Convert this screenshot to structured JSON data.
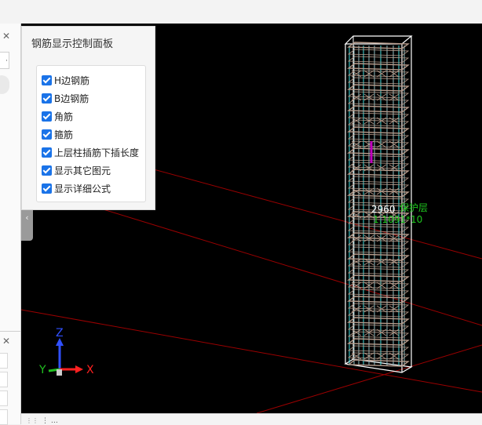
{
  "panel": {
    "title": "钢筋显示控制面板",
    "options": [
      {
        "label": "H边钢筋",
        "checked": true
      },
      {
        "label": "B边钢筋",
        "checked": true
      },
      {
        "label": "角筋",
        "checked": true
      },
      {
        "label": "箍筋",
        "checked": true
      },
      {
        "label": "上层柱插筋下插长度",
        "checked": true
      },
      {
        "label": "显示其它图元",
        "checked": true
      },
      {
        "label": "显示详细公式",
        "checked": true
      }
    ]
  },
  "viewport": {
    "annotation_value": "2960",
    "annotation_label": "保护层",
    "annotation_sub": "1.1091*10",
    "axis": {
      "x": "X",
      "y": "Y",
      "z": "Z"
    }
  },
  "left_panel": {
    "field_value": "·"
  },
  "statusbar": {
    "text": "⋮ …"
  },
  "colors": {
    "viewport_bg": "#000000",
    "checkbox": "#1a73e8",
    "annotation_green": "#1fc81f",
    "annotation_white": "#ffffff",
    "cage_white": "#ffffff",
    "bar_cyan": "#40e0e0",
    "stirrup": "#b59a8a",
    "grid_red": "#9b0000",
    "magenta": "#c000c0",
    "axis_x": "#ff2020",
    "axis_y": "#20c020",
    "axis_z": "#3050ff"
  }
}
